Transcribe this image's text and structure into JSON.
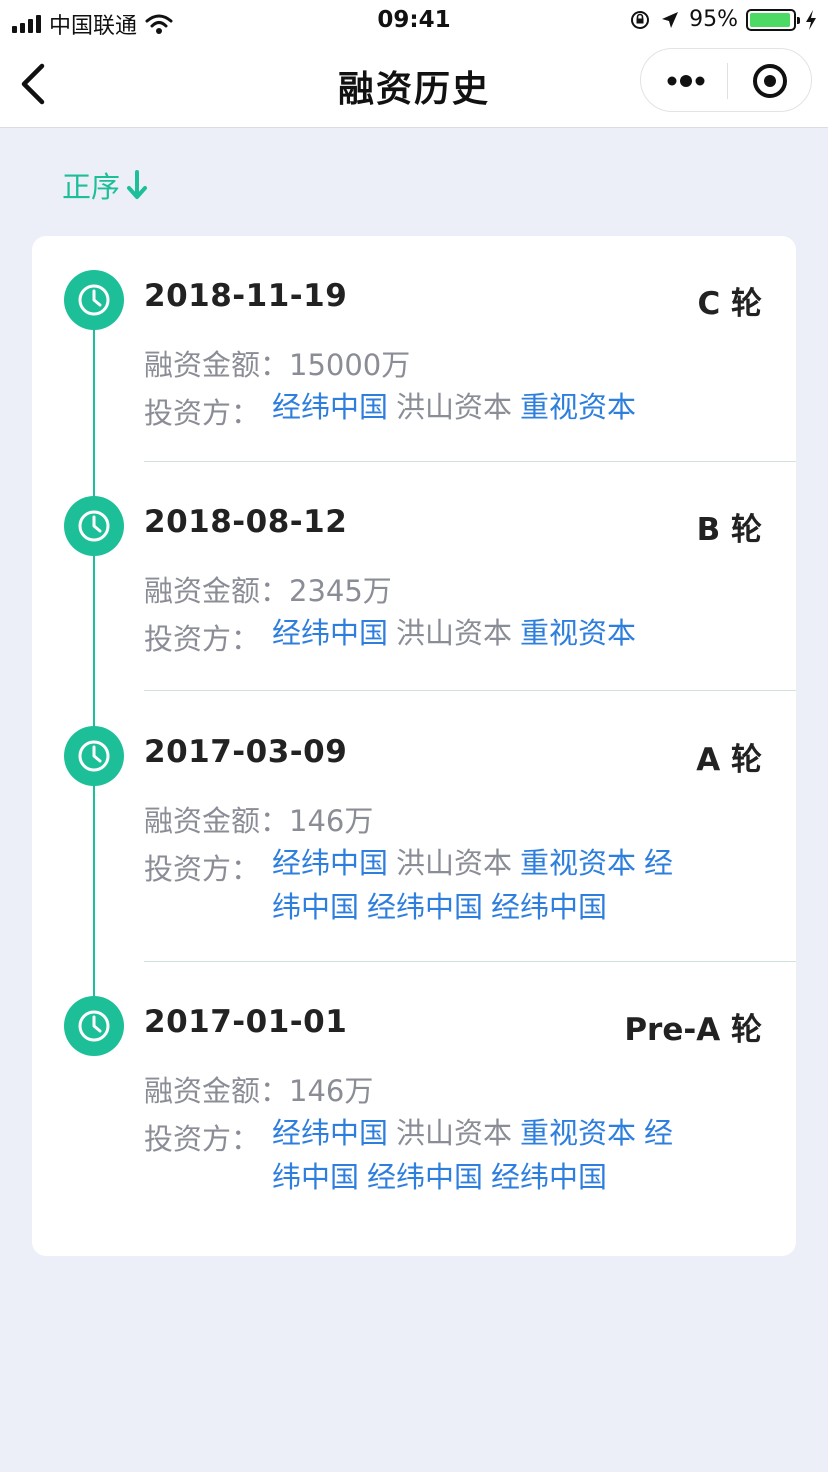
{
  "status_bar": {
    "carrier": "中国联通",
    "time": "09:41",
    "battery_percent": "95%",
    "battery_level": 0.95
  },
  "nav": {
    "title": "融资历史",
    "back_icon": "chevron-left-icon",
    "more_icon": "more-dots-icon",
    "close_icon": "target-circle-icon"
  },
  "sort": {
    "label": "正序",
    "icon": "arrow-down-icon"
  },
  "colors": {
    "accent": "#1dbf98",
    "link": "#2e7fdd",
    "muted": "#8a8d96",
    "background": "#eceff7"
  },
  "rounds": [
    {
      "date": "2018-11-19",
      "stage": "C 轮",
      "amount": "融资金额：15000万",
      "investors_label": "投资方：",
      "investors": [
        "经纬中国",
        "洪山资本",
        "重视资本"
      ]
    },
    {
      "date": "2018-08-12",
      "stage": "B 轮",
      "amount": "融资金额：2345万",
      "investors_label": "投资方：",
      "investors": [
        "经纬中国",
        "洪山资本",
        "重视资本"
      ]
    },
    {
      "date": "2017-03-09",
      "stage": "A 轮",
      "amount": "融资金额：146万",
      "investors_label": "投资方：",
      "investors": [
        "经纬中国",
        "洪山资本",
        "重视资本",
        "经纬中国",
        "经纬中国",
        "经纬中国"
      ]
    },
    {
      "date": "2017-01-01",
      "stage": "Pre-A 轮",
      "amount": "融资金额：146万",
      "investors_label": "投资方：",
      "investors": [
        "经纬中国",
        "洪山资本",
        "重视资本",
        "经纬中国",
        "经纬中国",
        "经纬中国"
      ]
    }
  ]
}
